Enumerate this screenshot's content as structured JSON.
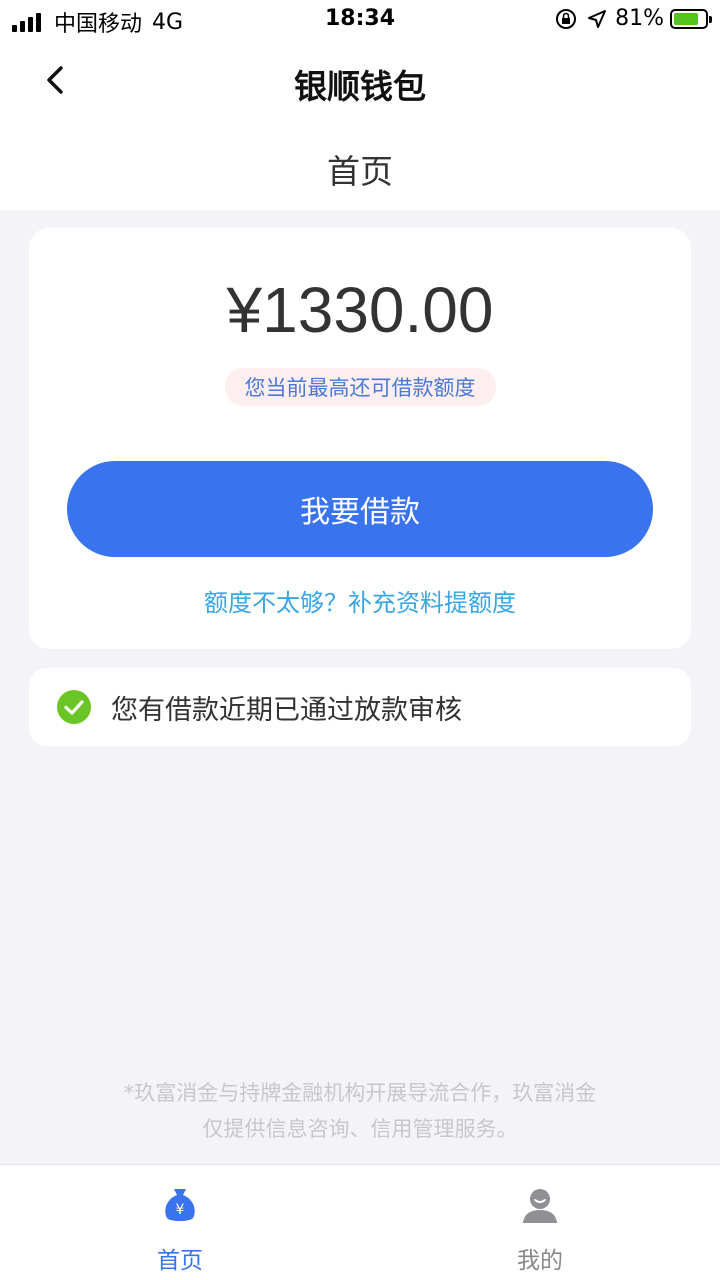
{
  "status_bar": {
    "carrier": "中国移动",
    "network": "4G",
    "time": "18:34",
    "battery": "81%",
    "battery_level": 0.81
  },
  "nav": {
    "title": "银顺钱包"
  },
  "page": {
    "title": "首页"
  },
  "loan": {
    "amount": "¥1330.00",
    "hint": "您当前最高还可借款额度",
    "borrow_button": "我要借款",
    "raise_link": "额度不太够？补充资料提额度"
  },
  "notice": {
    "text": "您有借款近期已通过放款审核"
  },
  "disclaimer": {
    "line1": "*玖富消金与持牌金融机构开展导流合作，玖富消金",
    "line2": "仅提供信息咨询、信用管理服务。"
  },
  "tabbar": {
    "items": [
      {
        "label": "首页",
        "icon": "money-bag-icon",
        "active": true
      },
      {
        "label": "我的",
        "icon": "user-icon",
        "active": false
      }
    ]
  },
  "colors": {
    "primary": "#3a73ee",
    "link": "#3aa6e3",
    "success": "#6cc526",
    "background": "#f3f3f8"
  }
}
